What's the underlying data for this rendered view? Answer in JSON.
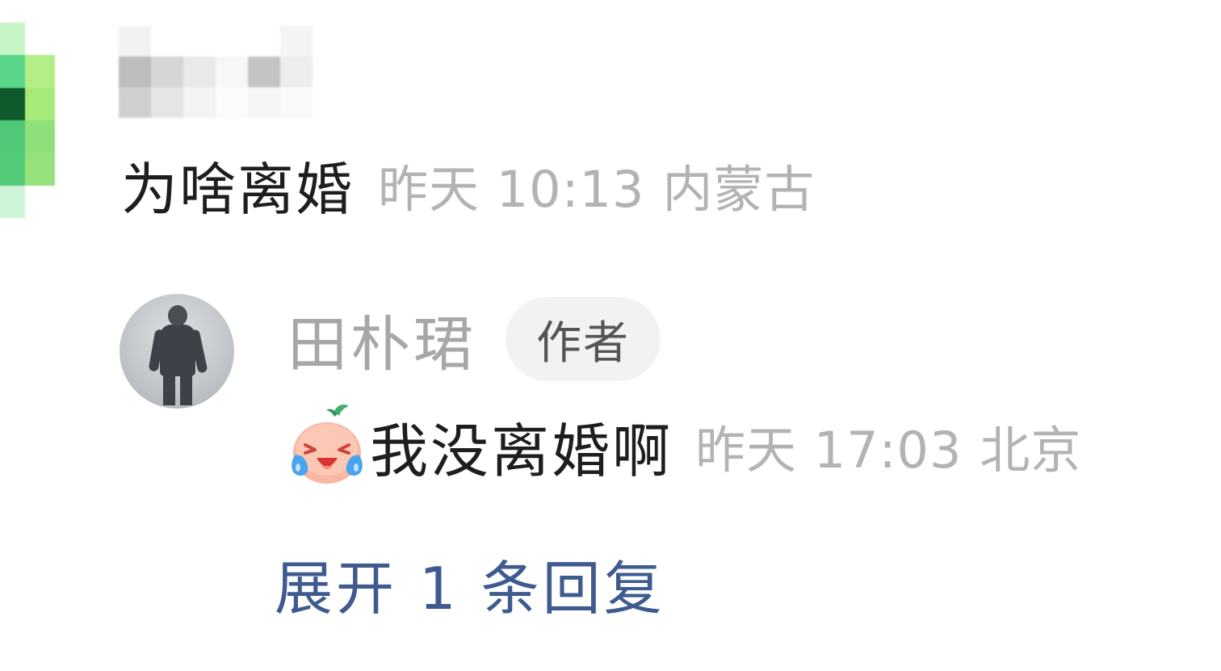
{
  "comment": {
    "text": "为啥离婚",
    "time": "昨天 10:13",
    "location": "内蒙古",
    "avatar_icon": "pixelated-avatar-icon",
    "username_state": "mosaic-blurred"
  },
  "reply": {
    "user_name": "田朴珺",
    "author_badge": "作者",
    "emoji_icon": "laugh-cry-emoji-icon",
    "text": "我没离婚啊",
    "time": "昨天 17:03",
    "location": "北京"
  },
  "expand_replies": {
    "label": "展开 1 条回复"
  },
  "colors": {
    "comment_text": "#1e1e1e",
    "meta_text": "#b3b3b3",
    "name_text": "#a7a7a7",
    "badge_bg": "#f2f2f2",
    "link": "#3e5a8f"
  }
}
